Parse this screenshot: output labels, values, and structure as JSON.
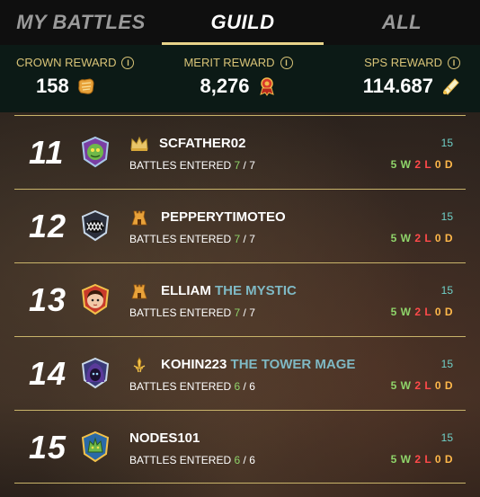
{
  "tabs": [
    {
      "label": "MY BATTLES",
      "active": false
    },
    {
      "label": "GUILD",
      "active": true
    },
    {
      "label": "ALL",
      "active": false
    }
  ],
  "rewards": [
    {
      "label": "CROWN REWARD",
      "value": "158",
      "icon": "crown-token-icon"
    },
    {
      "label": "MERIT REWARD",
      "value": "8,276",
      "icon": "merit-icon"
    },
    {
      "label": "SPS REWARD",
      "value": "114.687",
      "icon": "sps-icon"
    }
  ],
  "rows": [
    {
      "rank": "11",
      "name": "SCFATHER02",
      "title": "",
      "battles_label": "BATTLES ENTERED",
      "entered": "7",
      "total": "7",
      "score": "15",
      "w": "5 W",
      "l": "2 L",
      "d": "0 D",
      "role": "crown-icon",
      "avatar": "green-creature-avatar"
    },
    {
      "rank": "12",
      "name": "PEPPERYTIMOTEO",
      "title": "",
      "battles_label": "BATTLES ENTERED",
      "entered": "7",
      "total": "7",
      "score": "15",
      "w": "5 W",
      "l": "2 L",
      "d": "0 D",
      "role": "tower-icon",
      "avatar": "monster-mouth-avatar"
    },
    {
      "rank": "13",
      "name": "ELLIAM",
      "title": "THE MYSTIC",
      "battles_label": "BATTLES ENTERED",
      "entered": "7",
      "total": "7",
      "score": "15",
      "w": "5 W",
      "l": "2 L",
      "d": "0 D",
      "role": "tower-icon",
      "avatar": "girl-avatar"
    },
    {
      "rank": "14",
      "name": "KOHIN223",
      "title": "THE TOWER MAGE",
      "battles_label": "BATTLES ENTERED",
      "entered": "6",
      "total": "6",
      "score": "15",
      "w": "5 W",
      "l": "2 L",
      "d": "0 D",
      "role": "sword-icon",
      "avatar": "hooded-mage-avatar"
    },
    {
      "rank": "15",
      "name": "NODES101",
      "title": "",
      "battles_label": "BATTLES ENTERED",
      "entered": "6",
      "total": "6",
      "score": "15",
      "w": "5 W",
      "l": "2 L",
      "d": "0 D",
      "role": "",
      "avatar": "dragon-avatar"
    }
  ],
  "colors": {
    "accent_gold": "#d8c377",
    "win": "#8fd46a",
    "loss": "#ff4a4a",
    "draw": "#ffb84a",
    "title_teal": "#7fb9c4",
    "score_teal": "#6fd0c8"
  }
}
